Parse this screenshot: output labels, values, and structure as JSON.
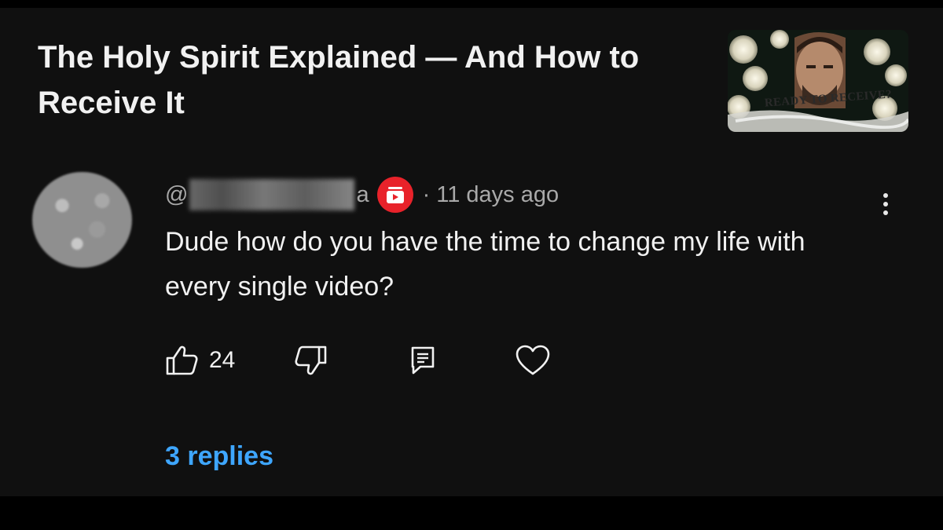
{
  "video": {
    "title": "The Holy Spirit Explained — And How to Receive It",
    "thumbnail_caption": "READY TO RECEIVE?"
  },
  "comment": {
    "handle_prefix": "@",
    "handle_suffix": "a",
    "separator": "·",
    "timestamp": "11 days ago",
    "text": "Dude how do you have the time to change my life with every single video?",
    "like_count": "24",
    "replies_label": "3 replies"
  },
  "icons": {
    "badge": "red-creator-badge-icon",
    "more": "vertical-ellipsis-icon",
    "like": "thumbs-up-icon",
    "dislike": "thumbs-down-icon",
    "reply": "comment-icon",
    "heart": "heart-icon"
  },
  "colors": {
    "background": "#101010",
    "text_primary": "#f1f1f1",
    "text_secondary": "#a9a9a9",
    "link_blue": "#3ea6ff",
    "badge_red": "#e8222a"
  }
}
